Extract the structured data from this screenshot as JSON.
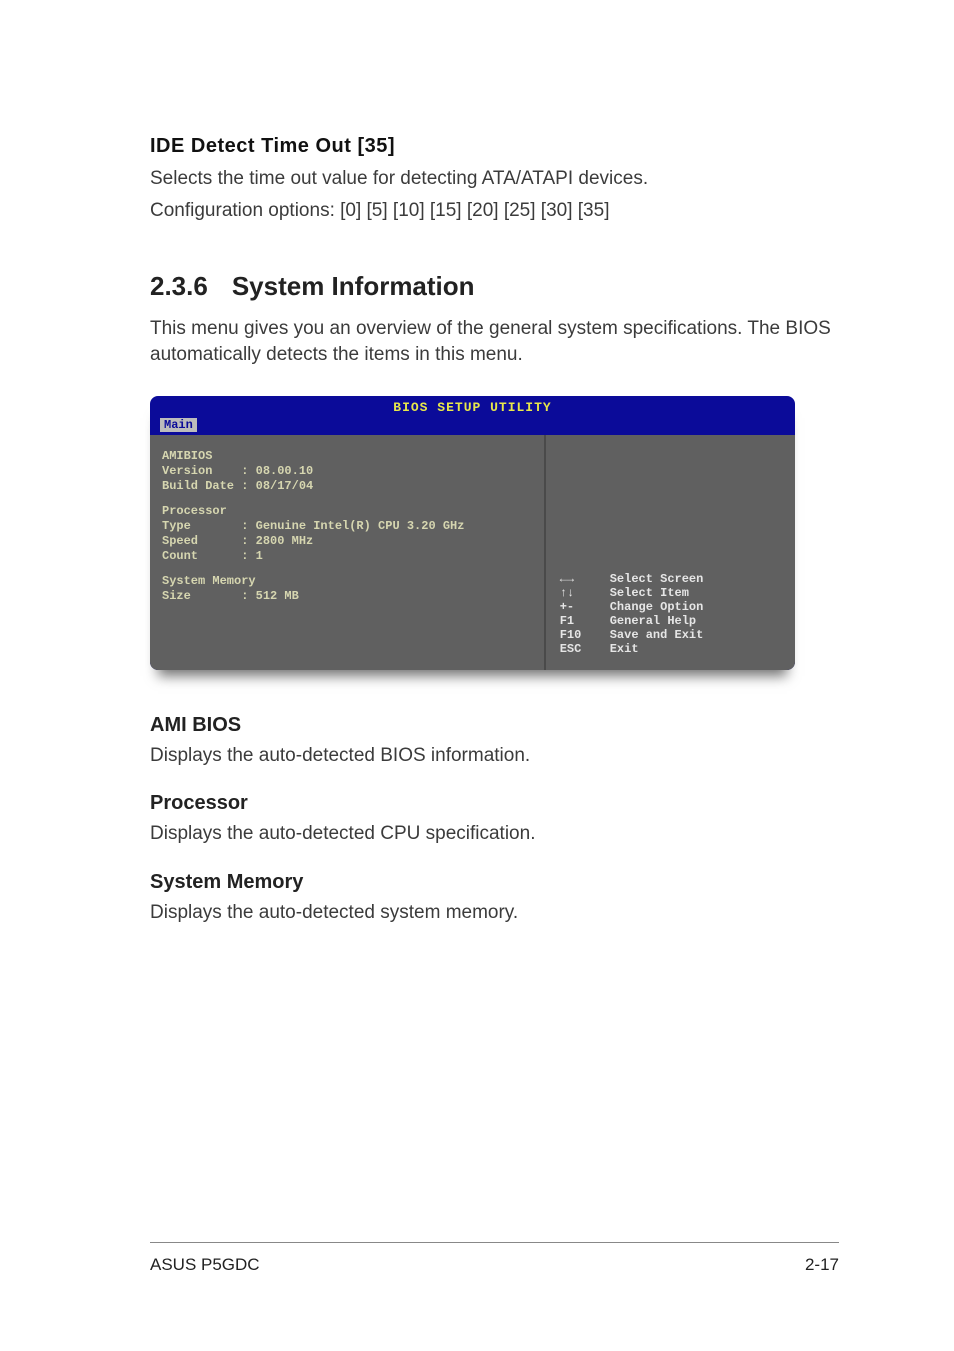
{
  "top_section": {
    "title": "IDE Detect Time Out [35]",
    "line1": "Selects the time out value for detecting ATA/ATAPI devices.",
    "line2": "Configuration options: [0] [5] [10] [15] [20] [25] [30] [35]"
  },
  "main_section": {
    "number": "2.3.6",
    "title": "System Information",
    "intro": "This menu gives you an overview of the general system specifications. The BIOS automatically detects the items in this menu."
  },
  "bios": {
    "header": "BIOS SETUP UTILITY",
    "tab": "Main",
    "amibios_label": "AMIBIOS",
    "version_line": "Version    : 08.00.10",
    "build_line": "Build Date : 08/17/04",
    "processor_label": "Processor",
    "proc_type": "Type       : Genuine Intel(R) CPU 3.20 GHz",
    "proc_speed": "Speed      : 2800 MHz",
    "proc_count": "Count      : 1",
    "sysmem_label": "System Memory",
    "sysmem_size": "Size       : 512 MB",
    "nav": [
      {
        "key": "←→",
        "label": "Select Screen"
      },
      {
        "key": "↑↓",
        "label": "Select Item"
      },
      {
        "key": "+-",
        "label": "Change Option"
      },
      {
        "key": "F1",
        "label": "General Help"
      },
      {
        "key": "F10",
        "label": "Save and Exit"
      },
      {
        "key": "ESC",
        "label": "Exit"
      }
    ]
  },
  "subsections": {
    "ami_title": "AMI BIOS",
    "ami_text": "Displays the auto-detected BIOS information.",
    "proc_title": "Processor",
    "proc_text": "Displays the auto-detected CPU specification.",
    "mem_title": "System Memory",
    "mem_text": "Displays the auto-detected system memory."
  },
  "footer": {
    "left": "ASUS P5GDC",
    "right": "2-17"
  }
}
